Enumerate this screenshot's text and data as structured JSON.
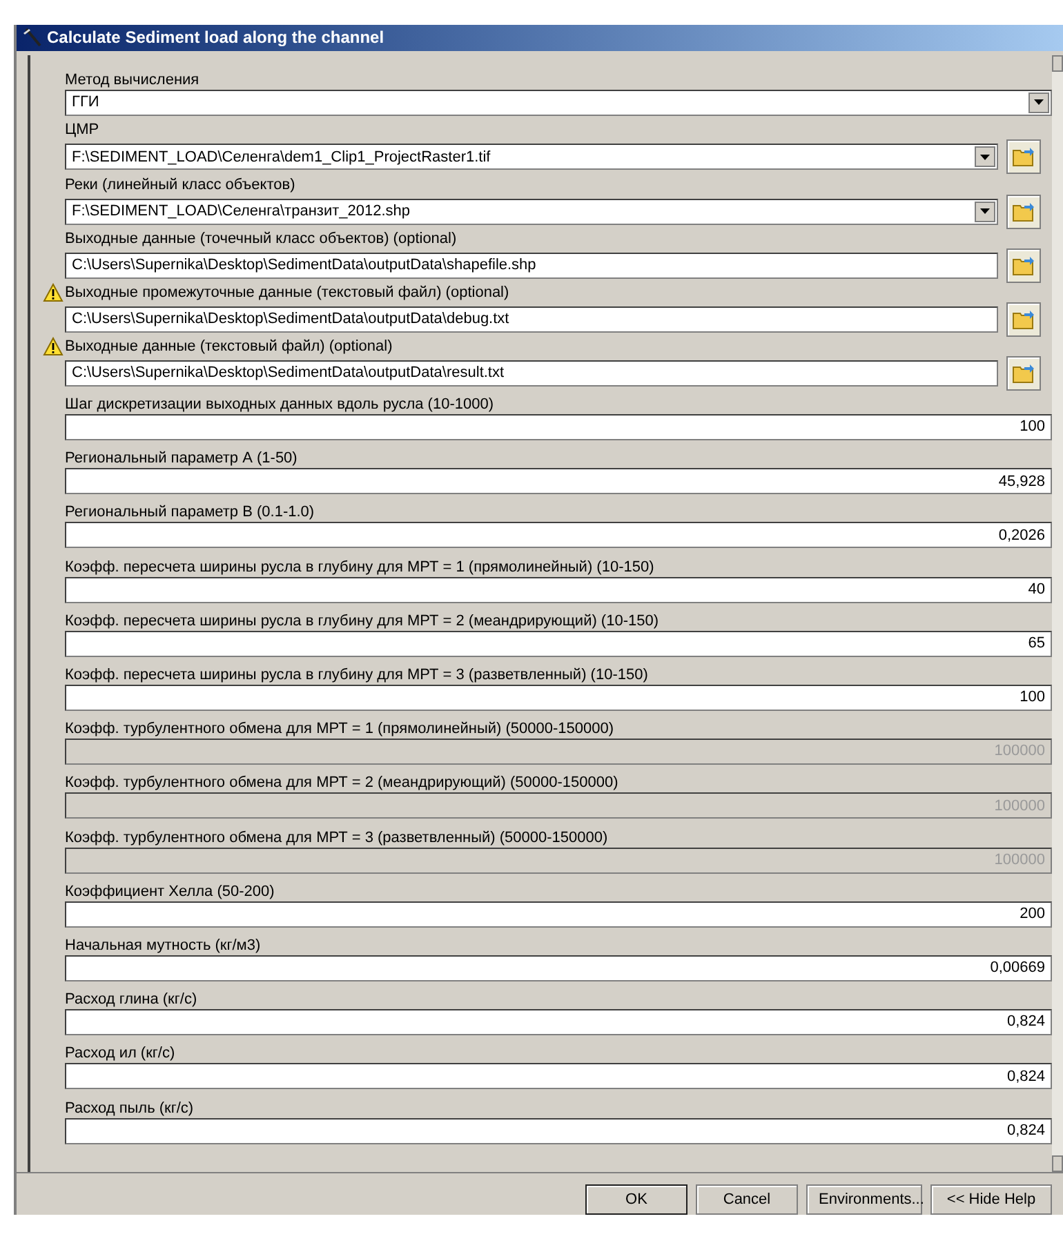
{
  "window": {
    "title": "Calculate Sediment load along the channel"
  },
  "parameters": [
    {
      "kind": "combo",
      "label": "Метод вычисления",
      "value": "ГГИ",
      "warning": false,
      "disabled": false
    },
    {
      "kind": "combo_file",
      "label": "ЦМР",
      "value": "F:\\SEDIMENT_LOAD\\Селенга\\dem1_Clip1_ProjectRaster1.tif",
      "warning": false,
      "disabled": false
    },
    {
      "kind": "combo_file",
      "label": "Реки (линейный класс объектов)",
      "value": "F:\\SEDIMENT_LOAD\\Селенга\\транзит_2012.shp",
      "warning": false,
      "disabled": false
    },
    {
      "kind": "file",
      "label": "Выходные данные (точечный класс объектов) (optional)",
      "value": "C:\\Users\\Supernika\\Desktop\\SedimentData\\outputData\\shapefile.shp",
      "warning": false,
      "disabled": false
    },
    {
      "kind": "file",
      "label": "Выходные промежуточные данные (текстовый файл) (optional)",
      "value": "C:\\Users\\Supernika\\Desktop\\SedimentData\\outputData\\debug.txt",
      "warning": true,
      "disabled": false
    },
    {
      "kind": "file",
      "label": "Выходные данные (текстовый файл) (optional)",
      "value": "C:\\Users\\Supernika\\Desktop\\SedimentData\\outputData\\result.txt",
      "warning": true,
      "disabled": false
    },
    {
      "kind": "number",
      "label": "Шаг дискретизации выходных данных вдоль русла (10-1000)",
      "value": "100",
      "warning": false,
      "disabled": false
    },
    {
      "kind": "number",
      "label": "Региональный параметр А (1-50)",
      "value": "45,928",
      "warning": false,
      "disabled": false
    },
    {
      "kind": "number",
      "label": "Региональный параметр В (0.1-1.0)",
      "value": "0,2026",
      "warning": false,
      "disabled": false
    },
    {
      "kind": "number",
      "label": "Коэфф. пересчета ширины русла в глубину для МРТ = 1 (прямолинейный) (10-150)",
      "value": "40",
      "warning": false,
      "disabled": false
    },
    {
      "kind": "number",
      "label": "Коэфф. пересчета ширины русла в глубину для МРТ = 2 (меандрирующий) (10-150)",
      "value": "65",
      "warning": false,
      "disabled": false
    },
    {
      "kind": "number",
      "label": "Коэфф. пересчета ширины русла в глубину для МРТ = 3 (разветвленный) (10-150)",
      "value": "100",
      "warning": false,
      "disabled": false
    },
    {
      "kind": "number",
      "label": "Коэфф. турбулентного обмена для МРТ = 1 (прямолинейный) (50000-150000)",
      "value": "100000",
      "warning": false,
      "disabled": true
    },
    {
      "kind": "number",
      "label": "Коэфф. турбулентного обмена для МРТ = 2 (меандрирующий) (50000-150000)",
      "value": "100000",
      "warning": false,
      "disabled": true
    },
    {
      "kind": "number",
      "label": "Коэфф. турбулентного обмена для МРТ = 3 (разветвленный) (50000-150000)",
      "value": "100000",
      "warning": false,
      "disabled": true
    },
    {
      "kind": "number",
      "label": "Коэффициент Хелла (50-200)",
      "value": "200",
      "warning": false,
      "disabled": false
    },
    {
      "kind": "number",
      "label": "Начальная мутность (кг/м3)",
      "value": "0,00669",
      "warning": false,
      "disabled": false
    },
    {
      "kind": "number",
      "label": "Расход глина (кг/с)",
      "value": "0,824",
      "warning": false,
      "disabled": false
    },
    {
      "kind": "number",
      "label": "Расход ил (кг/с)",
      "value": "0,824",
      "warning": false,
      "disabled": false
    },
    {
      "kind": "number",
      "label": "Расход пыль (кг/с)",
      "value": "0,824",
      "warning": false,
      "disabled": false
    }
  ],
  "buttons": [
    "OK",
    "Cancel",
    "Environments...",
    "<< Hide Help"
  ]
}
